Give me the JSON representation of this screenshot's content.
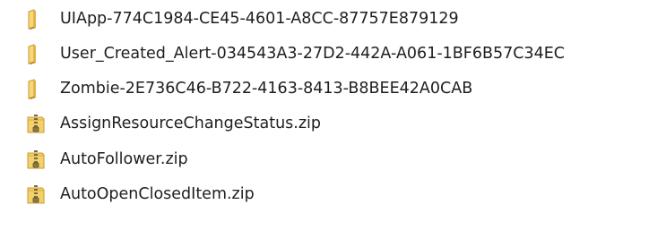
{
  "files": [
    {
      "name": "UIApp-774C1984-CE45-4601-A8CC-87757E879129",
      "icon": "folder-icon"
    },
    {
      "name": "User_Created_Alert-034543A3-27D2-442A-A061-1BF6B57C34EC",
      "icon": "folder-icon"
    },
    {
      "name": "Zombie-2E736C46-B722-4163-8413-B8BEE42A0CAB",
      "icon": "folder-icon"
    },
    {
      "name": "AssignResourceChangeStatus.zip",
      "icon": "zip-folder-icon"
    },
    {
      "name": "AutoFollower.zip",
      "icon": "zip-folder-icon"
    },
    {
      "name": "AutoOpenClosedItem.zip",
      "icon": "zip-folder-icon"
    }
  ],
  "colors": {
    "folder": "#e8c05a",
    "folder_dark": "#c99a2e",
    "zipper": "#7a6a3a"
  }
}
